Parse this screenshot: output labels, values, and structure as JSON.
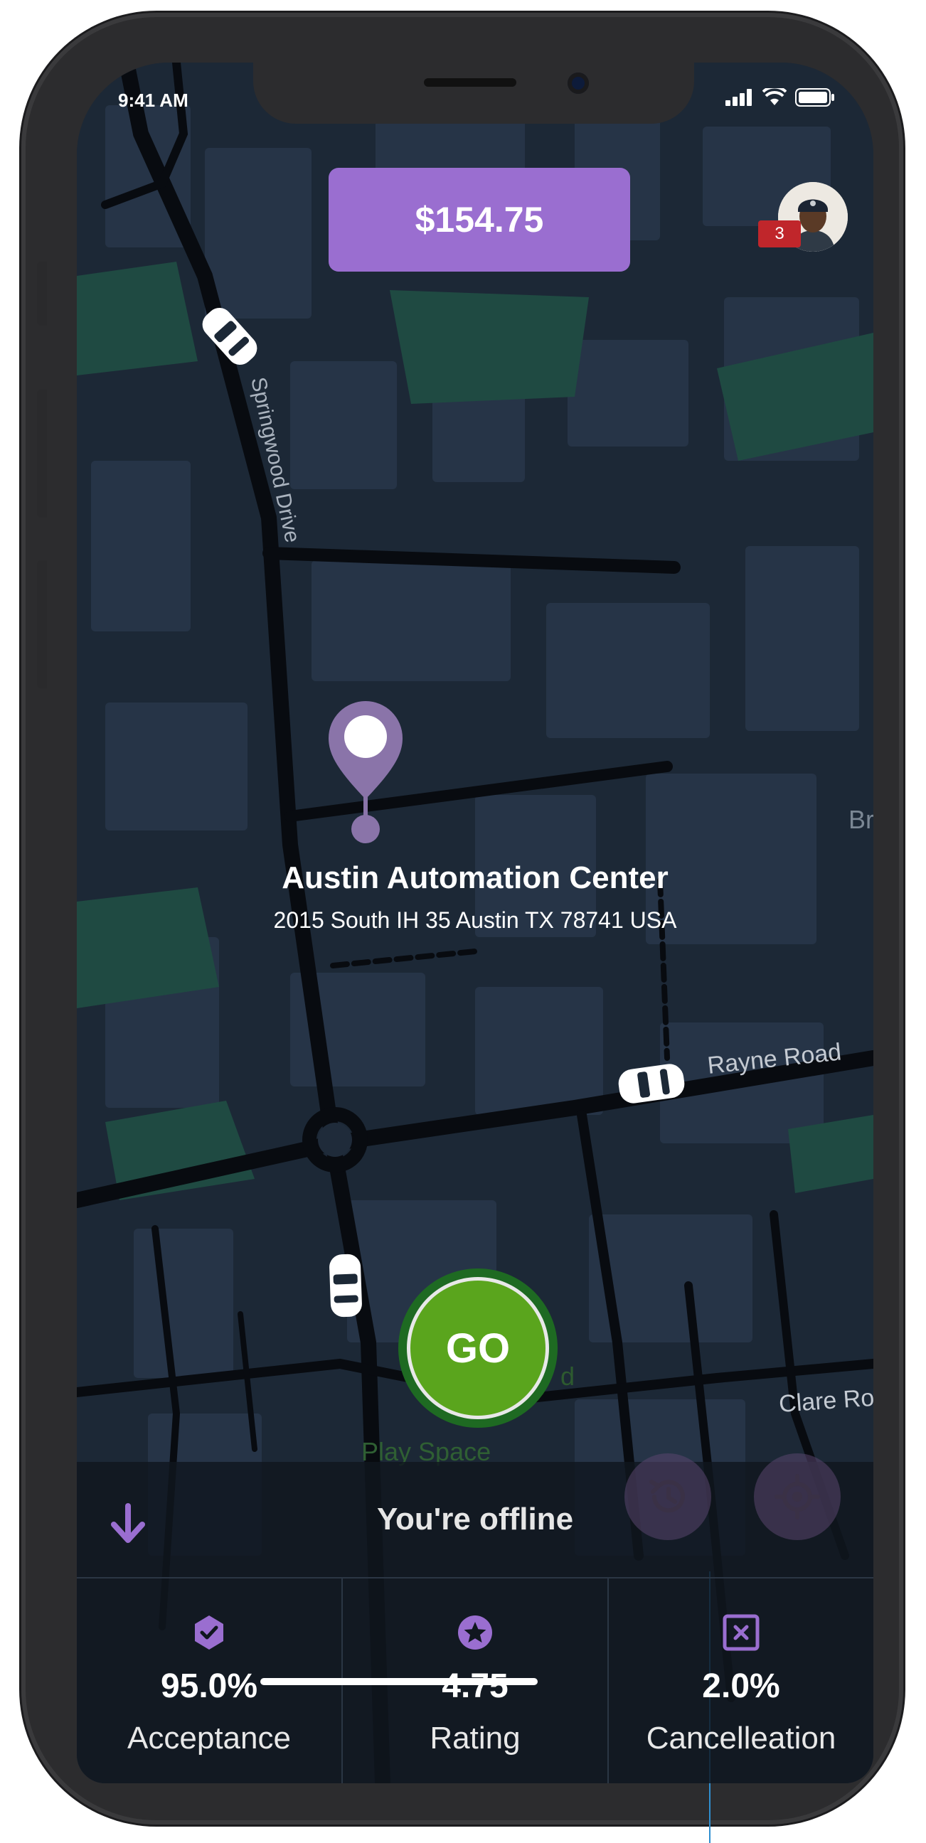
{
  "status_bar": {
    "time": "9:41 AM"
  },
  "earnings": {
    "amount": "$154.75"
  },
  "profile": {
    "notification_count": "3"
  },
  "map": {
    "streets": [
      "Springwood Drive",
      "Rayne Road",
      "Clare Ro",
      "Br"
    ],
    "place_partial": "Play Space",
    "place_partial_letter": "d"
  },
  "destination": {
    "name": "Austin Automation Center",
    "address": "2015 South IH 35 Austin TX 78741 USA"
  },
  "go_button": {
    "label": "GO"
  },
  "status": {
    "text": "You're offline"
  },
  "stats": [
    {
      "icon": "verified-shield-icon",
      "value": "95.0%",
      "label": "Acceptance"
    },
    {
      "icon": "star-circle-icon",
      "value": "4.75",
      "label": "Rating"
    },
    {
      "icon": "cancel-box-icon",
      "value": "2.0%",
      "label": "Cancelleation"
    }
  ],
  "colors": {
    "accent": "#9a6ed0",
    "go_green": "#5aa51d",
    "map_bg": "#1c2836",
    "badge_red": "#c0262b"
  }
}
